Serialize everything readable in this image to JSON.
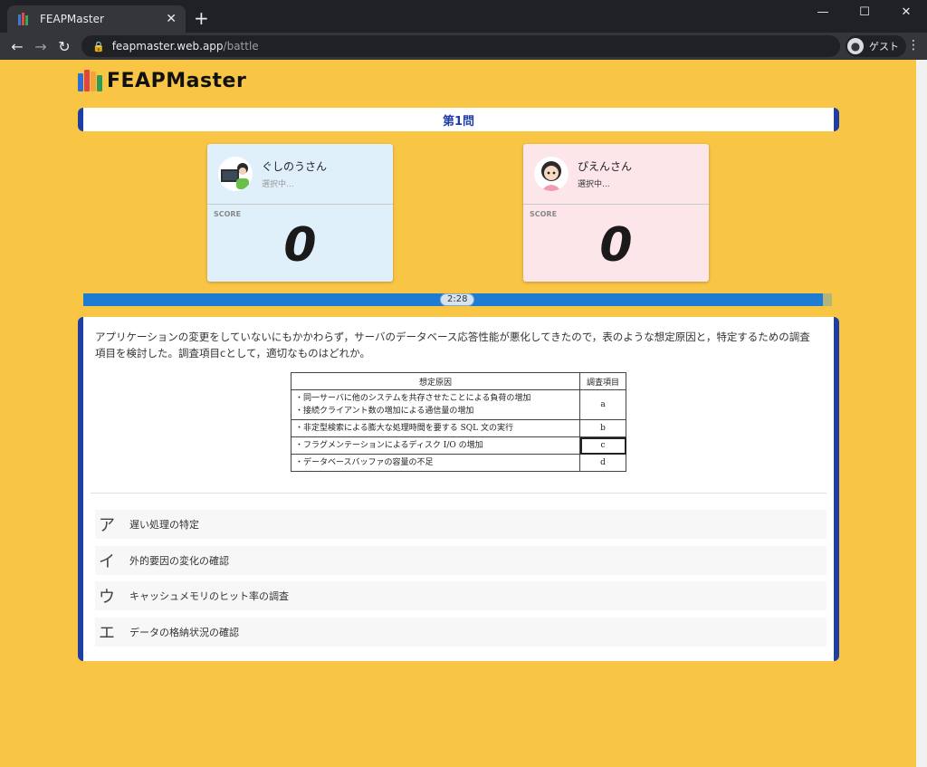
{
  "browser": {
    "tab_title": "FEAPMaster",
    "url_host": "feapmaster.web.app",
    "url_path": "/battle",
    "profile_label": "ゲスト"
  },
  "app": {
    "logo_text": "FEAPMaster"
  },
  "question_header": "第1問",
  "players": [
    {
      "name": "ぐしのうさん",
      "status": "選択中...",
      "score_label": "SCORE",
      "score": "0"
    },
    {
      "name": "ぴえんさん",
      "status": "選択中...",
      "score_label": "SCORE",
      "score": "0"
    }
  ],
  "timer": {
    "text": "2:28",
    "remaining_fraction": 0.988
  },
  "question": {
    "text": "アプリケーションの変更をしていないにもかかわらず，サーバのデータベース応答性能が悪化してきたので，表のような想定原因と，特定するための調査項目を検討した。調査項目cとして，適切なものはどれか。",
    "table": {
      "headers": [
        "想定原因",
        "調査項目"
      ],
      "rows": [
        {
          "causes": [
            "・同一サーバに他のシステムを共存させたことによる負荷の増加",
            "・接続クライアント数の増加による通信量の増加"
          ],
          "item": "a"
        },
        {
          "causes": [
            "・非定型検索による膨大な処理時間を要する SQL 文の実行"
          ],
          "item": "b"
        },
        {
          "causes": [
            "・フラグメンテーションによるディスク I/O の増加"
          ],
          "item": "c"
        },
        {
          "causes": [
            "・データベースバッファの容量の不足"
          ],
          "item": "d"
        }
      ]
    }
  },
  "choices": [
    {
      "letter": "ア",
      "text": "遅い処理の特定"
    },
    {
      "letter": "イ",
      "text": "外的要因の変化の確認"
    },
    {
      "letter": "ウ",
      "text": "キャッシュメモリのヒット率の調査"
    },
    {
      "letter": "エ",
      "text": "データの格納状況の確認"
    }
  ]
}
